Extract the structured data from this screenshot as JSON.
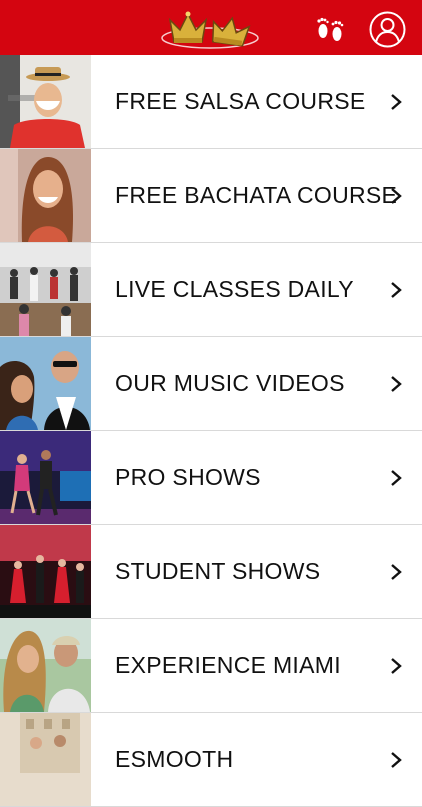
{
  "header": {
    "background": "#d40510",
    "logo_icon": "double-crown-logo",
    "feet_icon": "footprints-icon",
    "profile_icon": "user-profile-icon"
  },
  "menu": {
    "items": [
      {
        "label": "FREE SALSA COURSE",
        "thumb": "instructor-hat"
      },
      {
        "label": "FREE BACHATA COURSE",
        "thumb": "instructor-woman"
      },
      {
        "label": "LIVE CLASSES DAILY",
        "thumb": "class-group"
      },
      {
        "label": "OUR MUSIC VIDEOS",
        "thumb": "music-video"
      },
      {
        "label": "PRO SHOWS",
        "thumb": "pro-show"
      },
      {
        "label": "STUDENT SHOWS",
        "thumb": "student-show"
      },
      {
        "label": "EXPERIENCE MIAMI",
        "thumb": "experience-miami"
      },
      {
        "label": "ESMOOTH",
        "thumb": "partial-row"
      }
    ]
  }
}
